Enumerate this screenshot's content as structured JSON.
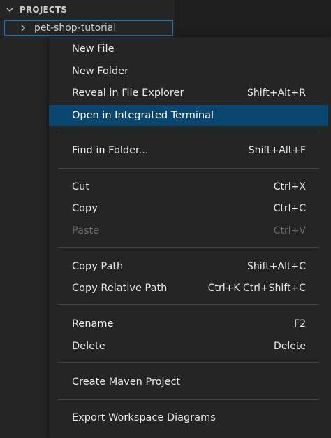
{
  "explorer": {
    "section_title": "PROJECTS",
    "project_name": "pet-shop-tutorial"
  },
  "menu": {
    "groups": [
      [
        {
          "label": "New File",
          "shortcut": ""
        },
        {
          "label": "New Folder",
          "shortcut": ""
        },
        {
          "label": "Reveal in File Explorer",
          "shortcut": "Shift+Alt+R"
        },
        {
          "label": "Open in Integrated Terminal",
          "shortcut": "",
          "active": true
        }
      ],
      [
        {
          "label": "Find in Folder...",
          "shortcut": "Shift+Alt+F"
        }
      ],
      [
        {
          "label": "Cut",
          "shortcut": "Ctrl+X"
        },
        {
          "label": "Copy",
          "shortcut": "Ctrl+C"
        },
        {
          "label": "Paste",
          "shortcut": "Ctrl+V",
          "disabled": true
        }
      ],
      [
        {
          "label": "Copy Path",
          "shortcut": "Shift+Alt+C"
        },
        {
          "label": "Copy Relative Path",
          "shortcut": "Ctrl+K Ctrl+Shift+C"
        }
      ],
      [
        {
          "label": "Rename",
          "shortcut": "F2"
        },
        {
          "label": "Delete",
          "shortcut": "Delete"
        }
      ],
      [
        {
          "label": "Create Maven Project",
          "shortcut": ""
        }
      ],
      [
        {
          "label": "Export Workspace Diagrams",
          "shortcut": ""
        }
      ]
    ]
  },
  "colors": {
    "menu_bg": "#252526",
    "active_bg": "#094771",
    "focus_border": "#007fd4",
    "disabled_text": "#6b6b6b"
  }
}
